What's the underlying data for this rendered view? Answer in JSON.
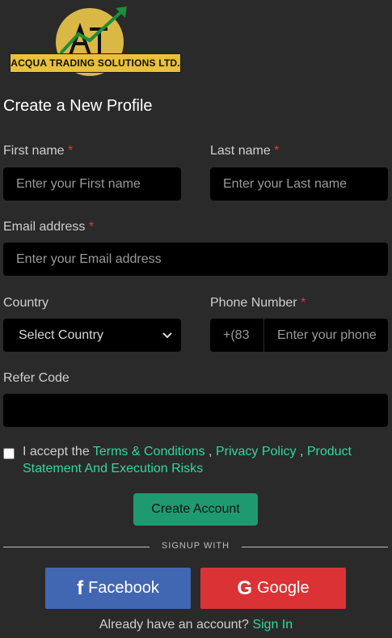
{
  "logo": {
    "brand_text": "ACQUA TRADING SOLUTIONS LTD.",
    "monogram": "AT"
  },
  "form": {
    "title": "Create a New Profile",
    "first_name": {
      "label": "First name",
      "required": "*",
      "placeholder": "Enter your First name"
    },
    "last_name": {
      "label": "Last name",
      "required": "*",
      "placeholder": "Enter your Last name"
    },
    "email": {
      "label": "Email address",
      "required": "*",
      "placeholder": "Enter your Email address"
    },
    "country": {
      "label": "Country",
      "selected": "Select Country"
    },
    "phone": {
      "label": "Phone Number",
      "required": "*",
      "prefix": "+(83",
      "placeholder": "Enter your phone"
    },
    "refer": {
      "label": "Refer Code",
      "value": ""
    },
    "terms": {
      "prefix": "I accept the ",
      "link1": "Terms & Conditions",
      "sep1": " , ",
      "link2": "Privacy Policy",
      "sep2": " , ",
      "link3": "Product Statement And Execution Risks"
    },
    "submit_label": "Create Account"
  },
  "signup": {
    "divider_text": "SIGNUP WITH",
    "facebook_label": "Facebook",
    "google_label": "Google"
  },
  "footer": {
    "text": "Already have an account? ",
    "link": "Sign In"
  },
  "colors": {
    "accent": "#2fd8a0",
    "button": "#1f9a70",
    "facebook": "#4267b2",
    "google": "#db3236",
    "required": "#e0383a"
  }
}
